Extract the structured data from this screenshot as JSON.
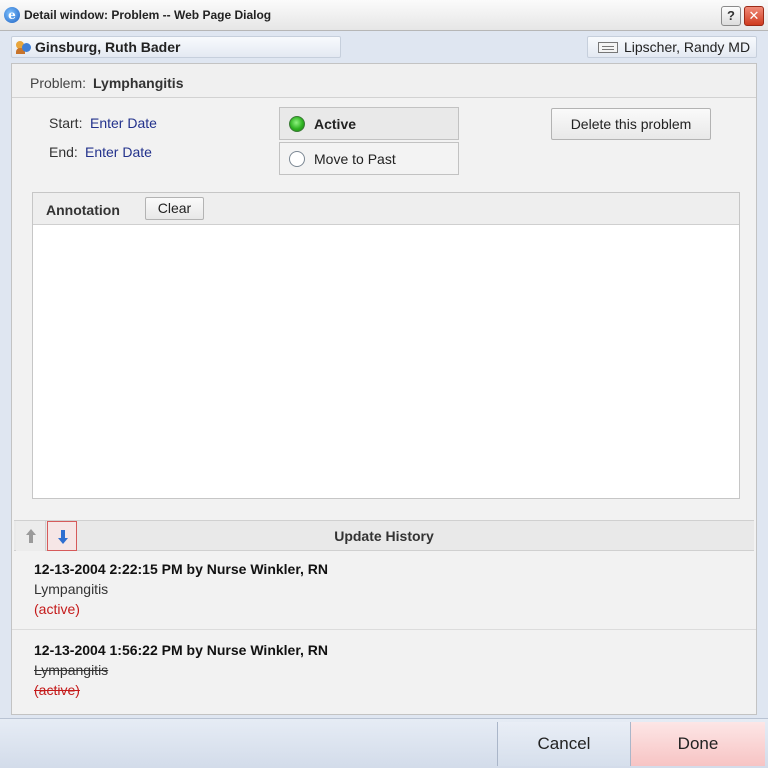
{
  "window": {
    "title": "Detail window: Problem -- Web Page Dialog",
    "help_label": "?",
    "close_label": "✕",
    "app_icon_glyph": "e"
  },
  "header": {
    "patient_name": "Ginsburg, Ruth Bader",
    "provider_name": "Lipscher, Randy MD"
  },
  "problem": {
    "label": "Problem:",
    "name": "Lymphangitis",
    "start_label": "Start:",
    "start_link": "Enter Date",
    "end_label": "End:",
    "end_link": "Enter Date",
    "status_options": [
      {
        "label": "Active",
        "selected": true
      },
      {
        "label": "Move to Past",
        "selected": false
      }
    ],
    "delete_label": "Delete this problem"
  },
  "annotation": {
    "title": "Annotation",
    "clear_label": "Clear",
    "text": ""
  },
  "history": {
    "title": "Update History",
    "entries": [
      {
        "meta": "12-13-2004 2:22:15 PM by Nurse Winkler, RN",
        "problem": "Lympangitis",
        "status": "(active)",
        "struck": false
      },
      {
        "meta": "12-13-2004 1:56:22 PM by Nurse Winkler, RN",
        "problem": "Lympangitis",
        "status": "(active)",
        "struck": true
      }
    ]
  },
  "footer": {
    "cancel_label": "Cancel",
    "done_label": "Done"
  },
  "colors": {
    "link": "#23328c",
    "status_red": "#c41a1a",
    "radio_green": "#2fb322",
    "done_bg": "#f7c4c4"
  }
}
